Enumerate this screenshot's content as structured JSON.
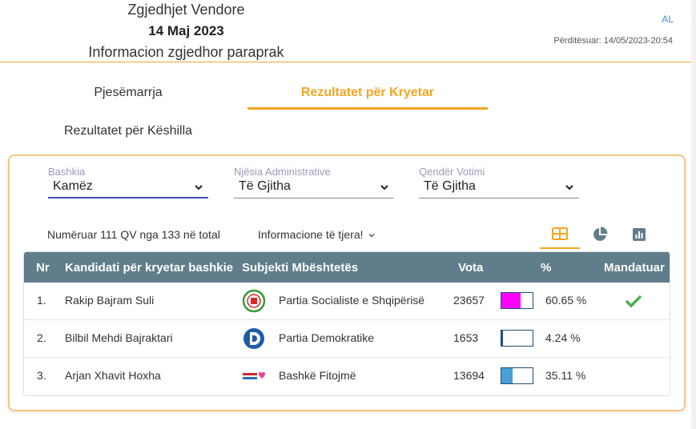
{
  "header": {
    "line1": "Zgjedhjet Vendore",
    "line2": "14 Maj 2023",
    "line3": "Informacion zgjedhor paraprak",
    "language": "AL",
    "updated": "Përditësuar: 14/05/2023-20:54"
  },
  "tabs": {
    "participation": "Pjesëmarrja",
    "mayor_results": "Rezultatet për Kryetar",
    "council_results": "Rezultatet për Këshilla"
  },
  "filters": {
    "municipality": {
      "label": "Bashkia",
      "value": "Kamëz"
    },
    "admin_unit": {
      "label": "Njësia Administrative",
      "value": "Të Gjitha"
    },
    "voting_center": {
      "label": "Qendër Votimi",
      "value": "Të Gjitha"
    }
  },
  "summary": {
    "counted": "Numëruar 111 QV nga 133 në total",
    "more_info": "Informacione të tjera!"
  },
  "view_icons": [
    "table-icon",
    "pie-chart-icon",
    "bar-chart-icon"
  ],
  "table": {
    "headers": {
      "nr": "Nr",
      "candidate": "Kandidati për kryetar bashkie",
      "party": "Subjekti Mbështetës",
      "votes": "Vota",
      "percent": "%",
      "mandate": "Mandatuar"
    },
    "rows": [
      {
        "nr": "1.",
        "candidate": "Rakip Bajram Suli",
        "party": "Partia Socialiste e Shqipërisë",
        "votes": "23657",
        "percent": "60.65 %",
        "share": 60.65,
        "color": "#ff00ff",
        "mandate": true,
        "logo": "ps-logo-icon"
      },
      {
        "nr": "2.",
        "candidate": "Bilbil Mehdi Bajraktari",
        "party": "Partia Demokratike",
        "votes": "1653",
        "percent": "4.24 %",
        "share": 4.24,
        "color": "#1f4e79",
        "mandate": false,
        "logo": "pd-logo-icon"
      },
      {
        "nr": "3.",
        "candidate": "Arjan Xhavit Hoxha",
        "party": "Bashkë Fitojmë",
        "votes": "13694",
        "percent": "35.11 %",
        "share": 35.11,
        "color": "#4a9fd8",
        "mandate": false,
        "logo": "bf-logo-icon"
      }
    ]
  },
  "colors": {
    "accent": "#f5a623",
    "table_header": "#607d8b",
    "check": "#4caf50"
  }
}
